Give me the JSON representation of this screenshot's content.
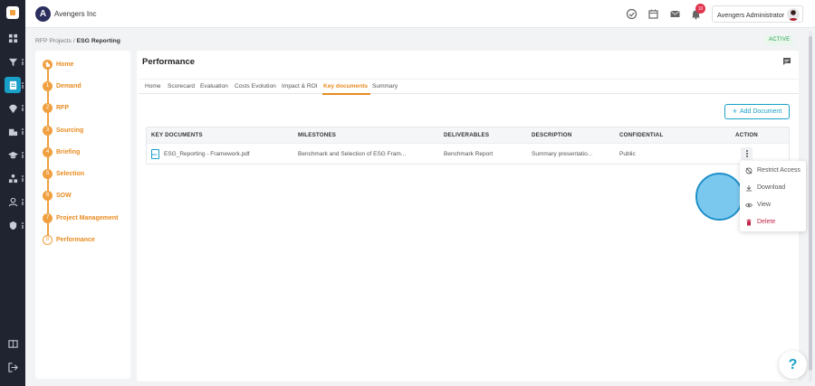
{
  "org": {
    "name": "Avengers Inc",
    "logo_letter": "A"
  },
  "user": {
    "name": "Avengers Administrator"
  },
  "notifications": {
    "count": "10"
  },
  "breadcrumb": {
    "parent": "RFP Projects",
    "separator": "/",
    "current": "ESG Reporting"
  },
  "status": "ACTIVE",
  "steps": [
    {
      "num": "",
      "label": "Home"
    },
    {
      "num": "1",
      "label": "Demand"
    },
    {
      "num": "2",
      "label": "RFP"
    },
    {
      "num": "3",
      "label": "Sourcing"
    },
    {
      "num": "4",
      "label": "Briefing"
    },
    {
      "num": "5",
      "label": "Selection"
    },
    {
      "num": "6",
      "label": "SOW"
    },
    {
      "num": "7",
      "label": "Project Management"
    },
    {
      "num": "8",
      "label": "Performance"
    }
  ],
  "main": {
    "title": "Performance",
    "tabs": [
      "Home",
      "Scorecard",
      "Evaluation",
      "Costs Evolution",
      "Impact & ROI",
      "Key documents",
      "Summary"
    ],
    "active_tab": "Key documents",
    "add_button": "Add Document"
  },
  "table": {
    "headers": [
      "KEY DOCUMENTS",
      "MILESTONES",
      "DELIVERABLES",
      "DESCRIPTION",
      "CONFIDENTIAL",
      "ACTION"
    ],
    "rows": [
      {
        "document": "ESG_Reporting - Framework.pdf",
        "milestone": "Benchmark and Selection of ESG Fram...",
        "deliverable": "Benchmark Report",
        "description": "Summary presentatio...",
        "confidential": "Public"
      }
    ]
  },
  "action_menu": [
    {
      "label": "Restrict Access",
      "icon": "restrict-access-icon"
    },
    {
      "label": "Download",
      "icon": "download-icon"
    },
    {
      "label": "View",
      "icon": "eye-icon"
    },
    {
      "label": "Delete",
      "icon": "trash-icon"
    }
  ],
  "help": "?",
  "colors": {
    "accent": "#f0a040",
    "primary": "#19a0c8",
    "danger": "#c0264a",
    "rail": "#1f2430"
  }
}
